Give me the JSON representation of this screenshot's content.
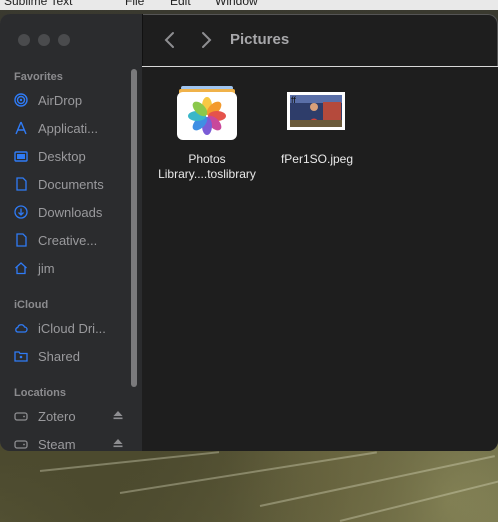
{
  "menubar": {
    "items": [
      "File",
      "Edit",
      "Window"
    ],
    "app_name": "Sublime Text"
  },
  "window": {
    "location_title": "Pictures"
  },
  "sidebar": {
    "favorites_title": "Favorites",
    "favorites": [
      {
        "label": "AirDrop",
        "icon": "airdrop-icon"
      },
      {
        "label": "Applicati...",
        "icon": "applications-icon"
      },
      {
        "label": "Desktop",
        "icon": "desktop-icon"
      },
      {
        "label": "Documents",
        "icon": "document-icon"
      },
      {
        "label": "Downloads",
        "icon": "download-icon"
      },
      {
        "label": "Creative...",
        "icon": "document-icon"
      },
      {
        "label": "jim",
        "icon": "home-icon"
      }
    ],
    "icloud_title": "iCloud",
    "icloud": [
      {
        "label": "iCloud Dri...",
        "icon": "cloud-icon"
      },
      {
        "label": "Shared",
        "icon": "shared-folder-icon"
      }
    ],
    "locations_title": "Locations",
    "locations": [
      {
        "label": "Zotero",
        "icon": "drive-icon"
      },
      {
        "label": "Steam",
        "icon": "drive-icon"
      }
    ]
  },
  "files": [
    {
      "name_line1": "Photos",
      "name_line2": "Library....toslibrary",
      "icon": "photos-library-icon"
    },
    {
      "name_line1": "fPer1SO.jpeg",
      "name_line2": "",
      "icon": "jpeg-thumbnail"
    }
  ],
  "colors": {
    "sidebar_bg": "#2b2c2e",
    "content_bg": "#1e1e1e",
    "sidebar_text": "#9a9a9d",
    "accent": "#2f7bf6"
  }
}
